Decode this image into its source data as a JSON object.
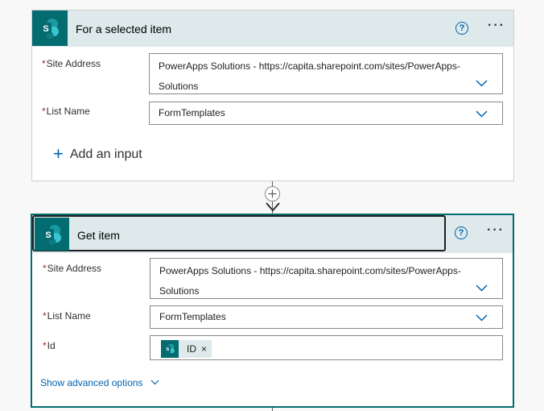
{
  "steps": [
    {
      "title": "For a selected item",
      "help_symbol": "?",
      "more_symbol": "···",
      "fields": [
        {
          "label": "Site Address",
          "required_mark": "*",
          "value_line1": "PowerApps Solutions - https://capita.sharepoint.com/sites/PowerApps-",
          "value_line2": "Solutions"
        },
        {
          "label": "List Name",
          "required_mark": "*",
          "value": "FormTemplates"
        }
      ],
      "add_input_icon": "+",
      "add_input_label": "Add an input"
    },
    {
      "title": "Get item",
      "help_symbol": "?",
      "more_symbol": "···",
      "fields": [
        {
          "label": "Site Address",
          "required_mark": "*",
          "value_line1": "PowerApps Solutions - https://capita.sharepoint.com/sites/PowerApps-",
          "value_line2": "Solutions"
        },
        {
          "label": "List Name",
          "required_mark": "*",
          "value": "FormTemplates"
        },
        {
          "label": "Id",
          "required_mark": "*",
          "token_label": "ID",
          "token_remove": "×"
        }
      ],
      "advanced_label": "Show advanced options"
    }
  ],
  "connector": {
    "icon": "plus-circle-icon"
  },
  "colors": {
    "sharepoint": "#036c70",
    "header_bg": "#dde9ea",
    "accent": "#0062b1",
    "required": "#a4262c"
  }
}
